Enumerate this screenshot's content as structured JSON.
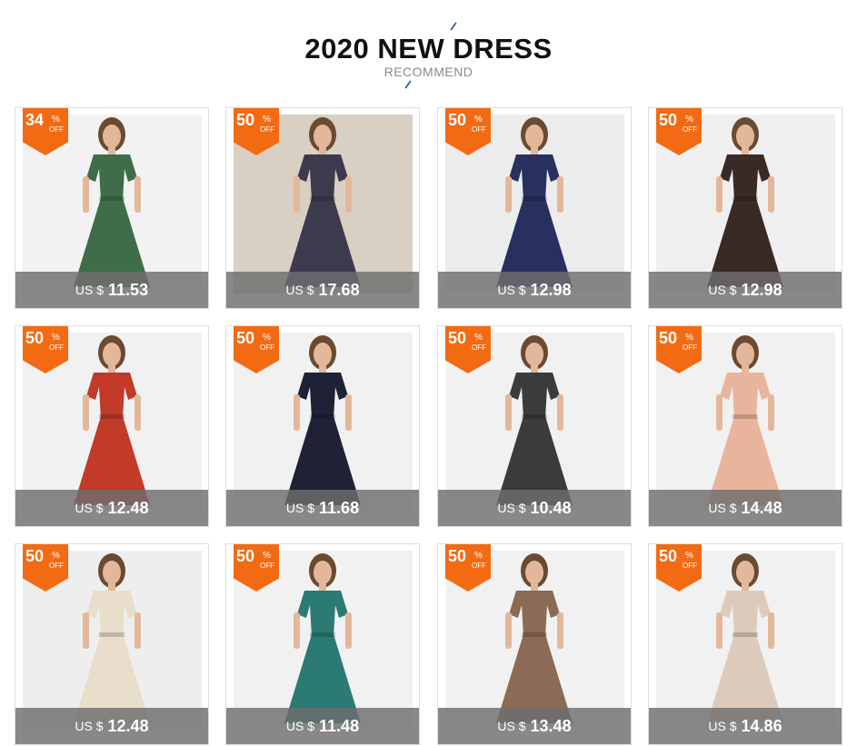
{
  "header": {
    "title": "2020 NEW DRESS",
    "subtitle": "RECOMMEND"
  },
  "colors": {
    "badge": "#f26b13",
    "price_bar": "#6e6e6e",
    "accent_slash": "#3b6db5"
  },
  "products": [
    {
      "discount": "34",
      "percent": "%",
      "off": "OFF",
      "currency": "US $",
      "price": "11.53",
      "dress_color": "#3f6d4a",
      "bg_color": "#f2f2f2"
    },
    {
      "discount": "50",
      "percent": "%",
      "off": "OFF",
      "currency": "US $",
      "price": "17.68",
      "dress_color": "#3d3a4e",
      "bg_color": "#d9cfc2"
    },
    {
      "discount": "50",
      "percent": "%",
      "off": "OFF",
      "currency": "US $",
      "price": "12.98",
      "dress_color": "#27305e",
      "bg_color": "#ececec"
    },
    {
      "discount": "50",
      "percent": "%",
      "off": "OFF",
      "currency": "US $",
      "price": "12.98",
      "dress_color": "#3a2a26",
      "bg_color": "#efefef"
    },
    {
      "discount": "50",
      "percent": "%",
      "off": "OFF",
      "currency": "US $",
      "price": "12.48",
      "dress_color": "#c23a28",
      "bg_color": "#f1f1f1"
    },
    {
      "discount": "50",
      "percent": "%",
      "off": "OFF",
      "currency": "US $",
      "price": "11.68",
      "dress_color": "#1f2236",
      "bg_color": "#f1f1f1"
    },
    {
      "discount": "50",
      "percent": "%",
      "off": "OFF",
      "currency": "US $",
      "price": "10.48",
      "dress_color": "#3b3b3b",
      "bg_color": "#f1f1f1"
    },
    {
      "discount": "50",
      "percent": "%",
      "off": "OFF",
      "currency": "US $",
      "price": "14.48",
      "dress_color": "#e8b59c",
      "bg_color": "#f1f1f1"
    },
    {
      "discount": "50",
      "percent": "%",
      "off": "OFF",
      "currency": "US $",
      "price": "12.48",
      "dress_color": "#e9ddcb",
      "bg_color": "#eeeeee"
    },
    {
      "discount": "50",
      "percent": "%",
      "off": "OFF",
      "currency": "US $",
      "price": "11.48",
      "dress_color": "#2b7a74",
      "bg_color": "#f1f1f1"
    },
    {
      "discount": "50",
      "percent": "%",
      "off": "OFF",
      "currency": "US $",
      "price": "13.48",
      "dress_color": "#8b6a56",
      "bg_color": "#f1f1f1"
    },
    {
      "discount": "50",
      "percent": "%",
      "off": "OFF",
      "currency": "US $",
      "price": "14.86",
      "dress_color": "#dccbbb",
      "bg_color": "#f1f1f1"
    }
  ]
}
